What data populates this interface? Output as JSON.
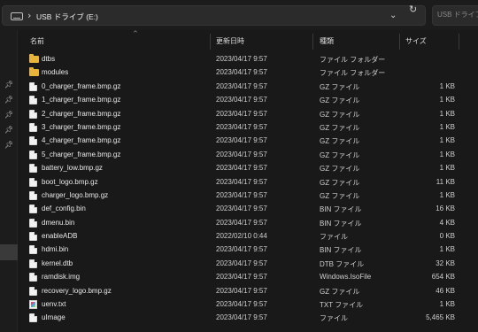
{
  "address": {
    "crumb_separator": "›",
    "location": "USB ドライブ (E:)",
    "search_placeholder": "USB ドライブ (E:)の検索"
  },
  "icons": {
    "drive": "drive-icon",
    "dropdown": "chevron-down-icon",
    "refresh": "refresh-icon",
    "pin": "pin-icon",
    "folder": "folder-icon",
    "file": "file-icon",
    "text_file": "text-file-icon"
  },
  "columns": {
    "name": "名前",
    "date": "更新日時",
    "type": "種類",
    "size": "サイズ"
  },
  "files": [
    {
      "name": "dtbs",
      "date": "2023/04/17 9:57",
      "type": "ファイル フォルダー",
      "size": "",
      "icon": "folder"
    },
    {
      "name": "modules",
      "date": "2023/04/17 9:57",
      "type": "ファイル フォルダー",
      "size": "",
      "icon": "folder"
    },
    {
      "name": "0_charger_frame.bmp.gz",
      "date": "2023/04/17 9:57",
      "type": "GZ ファイル",
      "size": "1 KB",
      "icon": "file"
    },
    {
      "name": "1_charger_frame.bmp.gz",
      "date": "2023/04/17 9:57",
      "type": "GZ ファイル",
      "size": "1 KB",
      "icon": "file"
    },
    {
      "name": "2_charger_frame.bmp.gz",
      "date": "2023/04/17 9:57",
      "type": "GZ ファイル",
      "size": "1 KB",
      "icon": "file"
    },
    {
      "name": "3_charger_frame.bmp.gz",
      "date": "2023/04/17 9:57",
      "type": "GZ ファイル",
      "size": "1 KB",
      "icon": "file"
    },
    {
      "name": "4_charger_frame.bmp.gz",
      "date": "2023/04/17 9:57",
      "type": "GZ ファイル",
      "size": "1 KB",
      "icon": "file"
    },
    {
      "name": "5_charger_frame.bmp.gz",
      "date": "2023/04/17 9:57",
      "type": "GZ ファイル",
      "size": "1 KB",
      "icon": "file"
    },
    {
      "name": "battery_low.bmp.gz",
      "date": "2023/04/17 9:57",
      "type": "GZ ファイル",
      "size": "1 KB",
      "icon": "file"
    },
    {
      "name": "boot_logo.bmp.gz",
      "date": "2023/04/17 9:57",
      "type": "GZ ファイル",
      "size": "11 KB",
      "icon": "file"
    },
    {
      "name": "charger_logo.bmp.gz",
      "date": "2023/04/17 9:57",
      "type": "GZ ファイル",
      "size": "1 KB",
      "icon": "file"
    },
    {
      "name": "def_config.bin",
      "date": "2023/04/17 9:57",
      "type": "BIN ファイル",
      "size": "16 KB",
      "icon": "file"
    },
    {
      "name": "dmenu.bin",
      "date": "2023/04/17 9:57",
      "type": "BIN ファイル",
      "size": "4 KB",
      "icon": "file"
    },
    {
      "name": "enableADB",
      "date": "2022/02/10 0:44",
      "type": "ファイル",
      "size": "0 KB",
      "icon": "file"
    },
    {
      "name": "hdmi.bin",
      "date": "2023/04/17 9:57",
      "type": "BIN ファイル",
      "size": "1 KB",
      "icon": "file"
    },
    {
      "name": "kernel.dtb",
      "date": "2023/04/17 9:57",
      "type": "DTB ファイル",
      "size": "32 KB",
      "icon": "file"
    },
    {
      "name": "ramdisk.img",
      "date": "2023/04/17 9:57",
      "type": "Windows.IsoFile",
      "size": "654 KB",
      "icon": "file"
    },
    {
      "name": "recovery_logo.bmp.gz",
      "date": "2023/04/17 9:57",
      "type": "GZ ファイル",
      "size": "46 KB",
      "icon": "file"
    },
    {
      "name": "uenv.txt",
      "date": "2023/04/17 9:57",
      "type": "TXT ファイル",
      "size": "1 KB",
      "icon": "txt"
    },
    {
      "name": "uImage",
      "date": "2023/04/17 9:57",
      "type": "ファイル",
      "size": "5,465 KB",
      "icon": "file"
    }
  ],
  "colors": {
    "background": "#191919",
    "folder": "#e8b43a",
    "selection": "#3a3a3a"
  }
}
